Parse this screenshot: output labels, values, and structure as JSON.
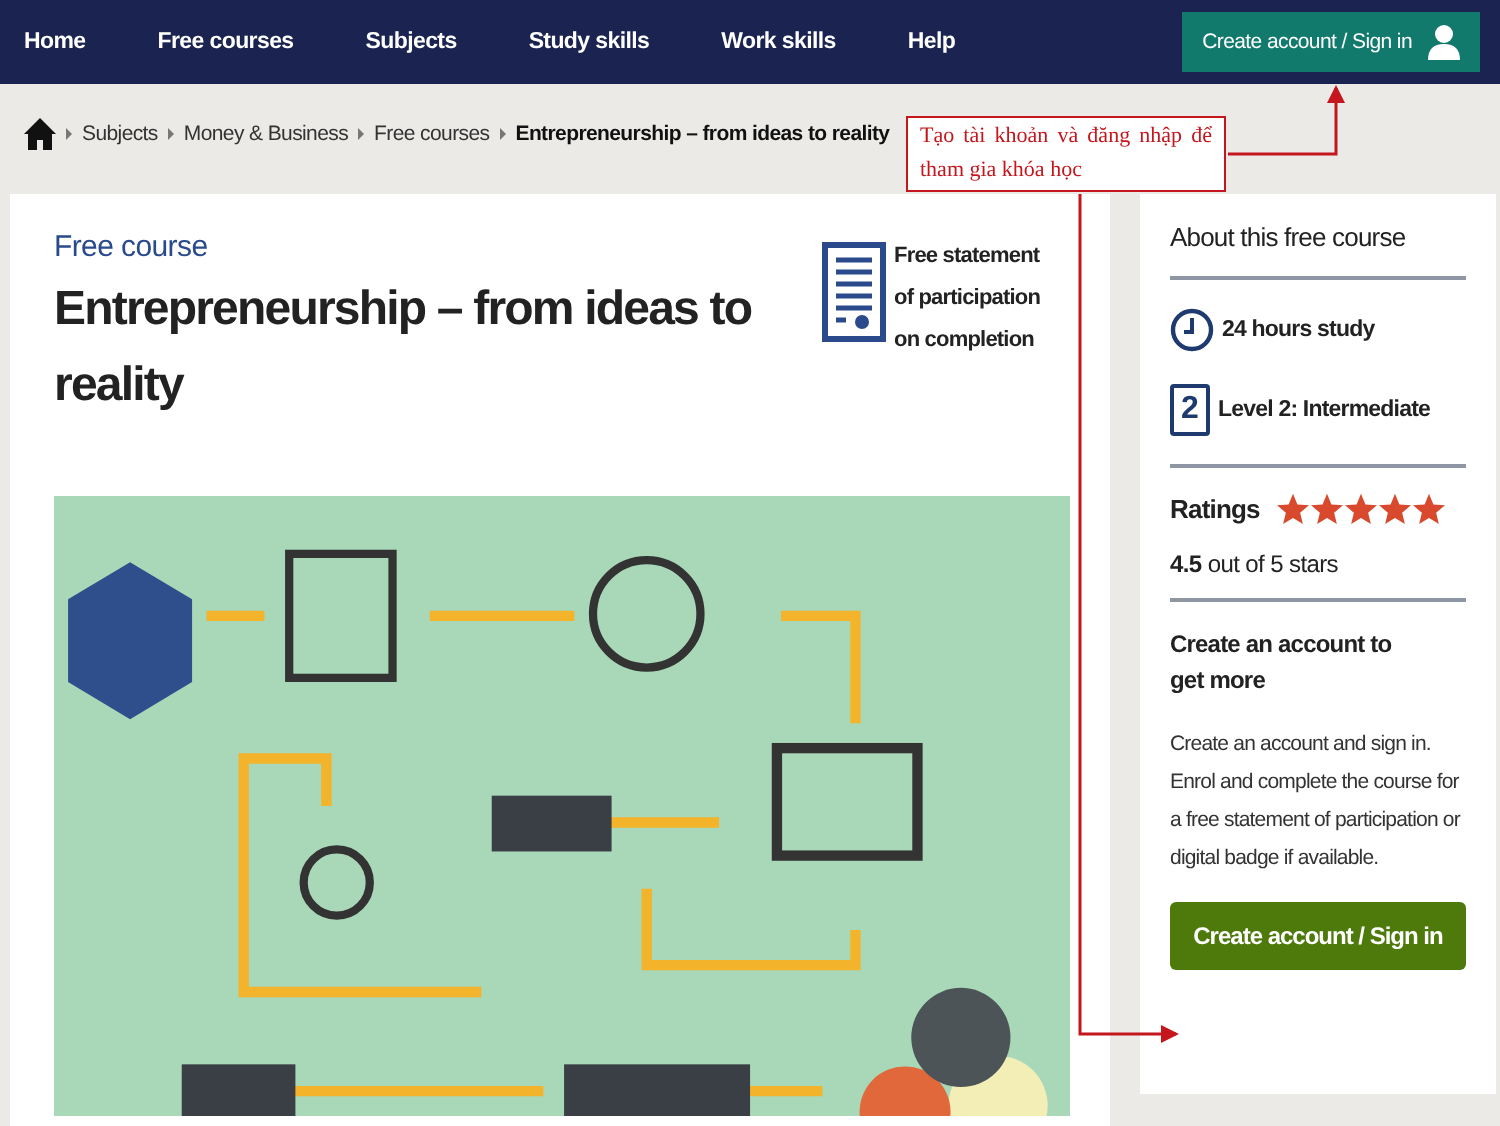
{
  "nav": {
    "items": [
      {
        "label": "Home"
      },
      {
        "label": "Free courses"
      },
      {
        "label": "Subjects"
      },
      {
        "label": "Study skills"
      },
      {
        "label": "Work skills"
      },
      {
        "label": "Help"
      }
    ],
    "account_button": "Create account / Sign in"
  },
  "breadcrumb": {
    "items": [
      "Subjects",
      "Money & Business",
      "Free courses"
    ],
    "current": "Entrepreneurship – from ideas to reality"
  },
  "annotation": {
    "text": "Tạo tài khoản và đăng nhập để tham gia khóa học"
  },
  "course": {
    "eyebrow": "Free course",
    "title": "Entrepreneurship – from ideas to reality",
    "statement": "Free statement of participation on completion"
  },
  "sidebar": {
    "heading": "About this free course",
    "facts": [
      {
        "kind": "clock",
        "text": "24 hours study"
      },
      {
        "kind": "level",
        "badge": "2",
        "text": "Level 2: Intermediate"
      }
    ],
    "ratings_label": "Ratings",
    "stars": 5,
    "rating_value": "4.5",
    "rating_suffix": "out of 5 stars",
    "cta_heading": "Create an account to get more",
    "cta_text": "Create an account and sign in. Enrol and complete the course for a free statement of participation or digital badge if available.",
    "cta_button": "Create account / Sign in"
  }
}
